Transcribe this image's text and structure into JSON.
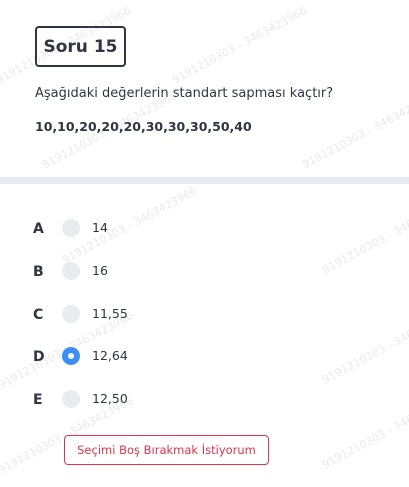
{
  "question": {
    "badge": "Soru 15",
    "text": "Aşağıdaki değerlerin standart sapması kaçtır?",
    "values": "10,10,20,20,20,30,30,30,50,40"
  },
  "options": [
    {
      "letter": "A",
      "value": "14",
      "selected": false
    },
    {
      "letter": "B",
      "value": "16",
      "selected": false
    },
    {
      "letter": "C",
      "value": "11,55",
      "selected": false
    },
    {
      "letter": "D",
      "value": "12,64",
      "selected": true
    },
    {
      "letter": "E",
      "value": "12,50",
      "selected": false
    }
  ],
  "skip_button": "Seçimi Boş Bırakmak İstiyorum",
  "watermark": "9191210303 - 3463423966",
  "colors": {
    "accent": "#3b8ff2",
    "danger": "#e0334d",
    "text": "#2f3542"
  }
}
